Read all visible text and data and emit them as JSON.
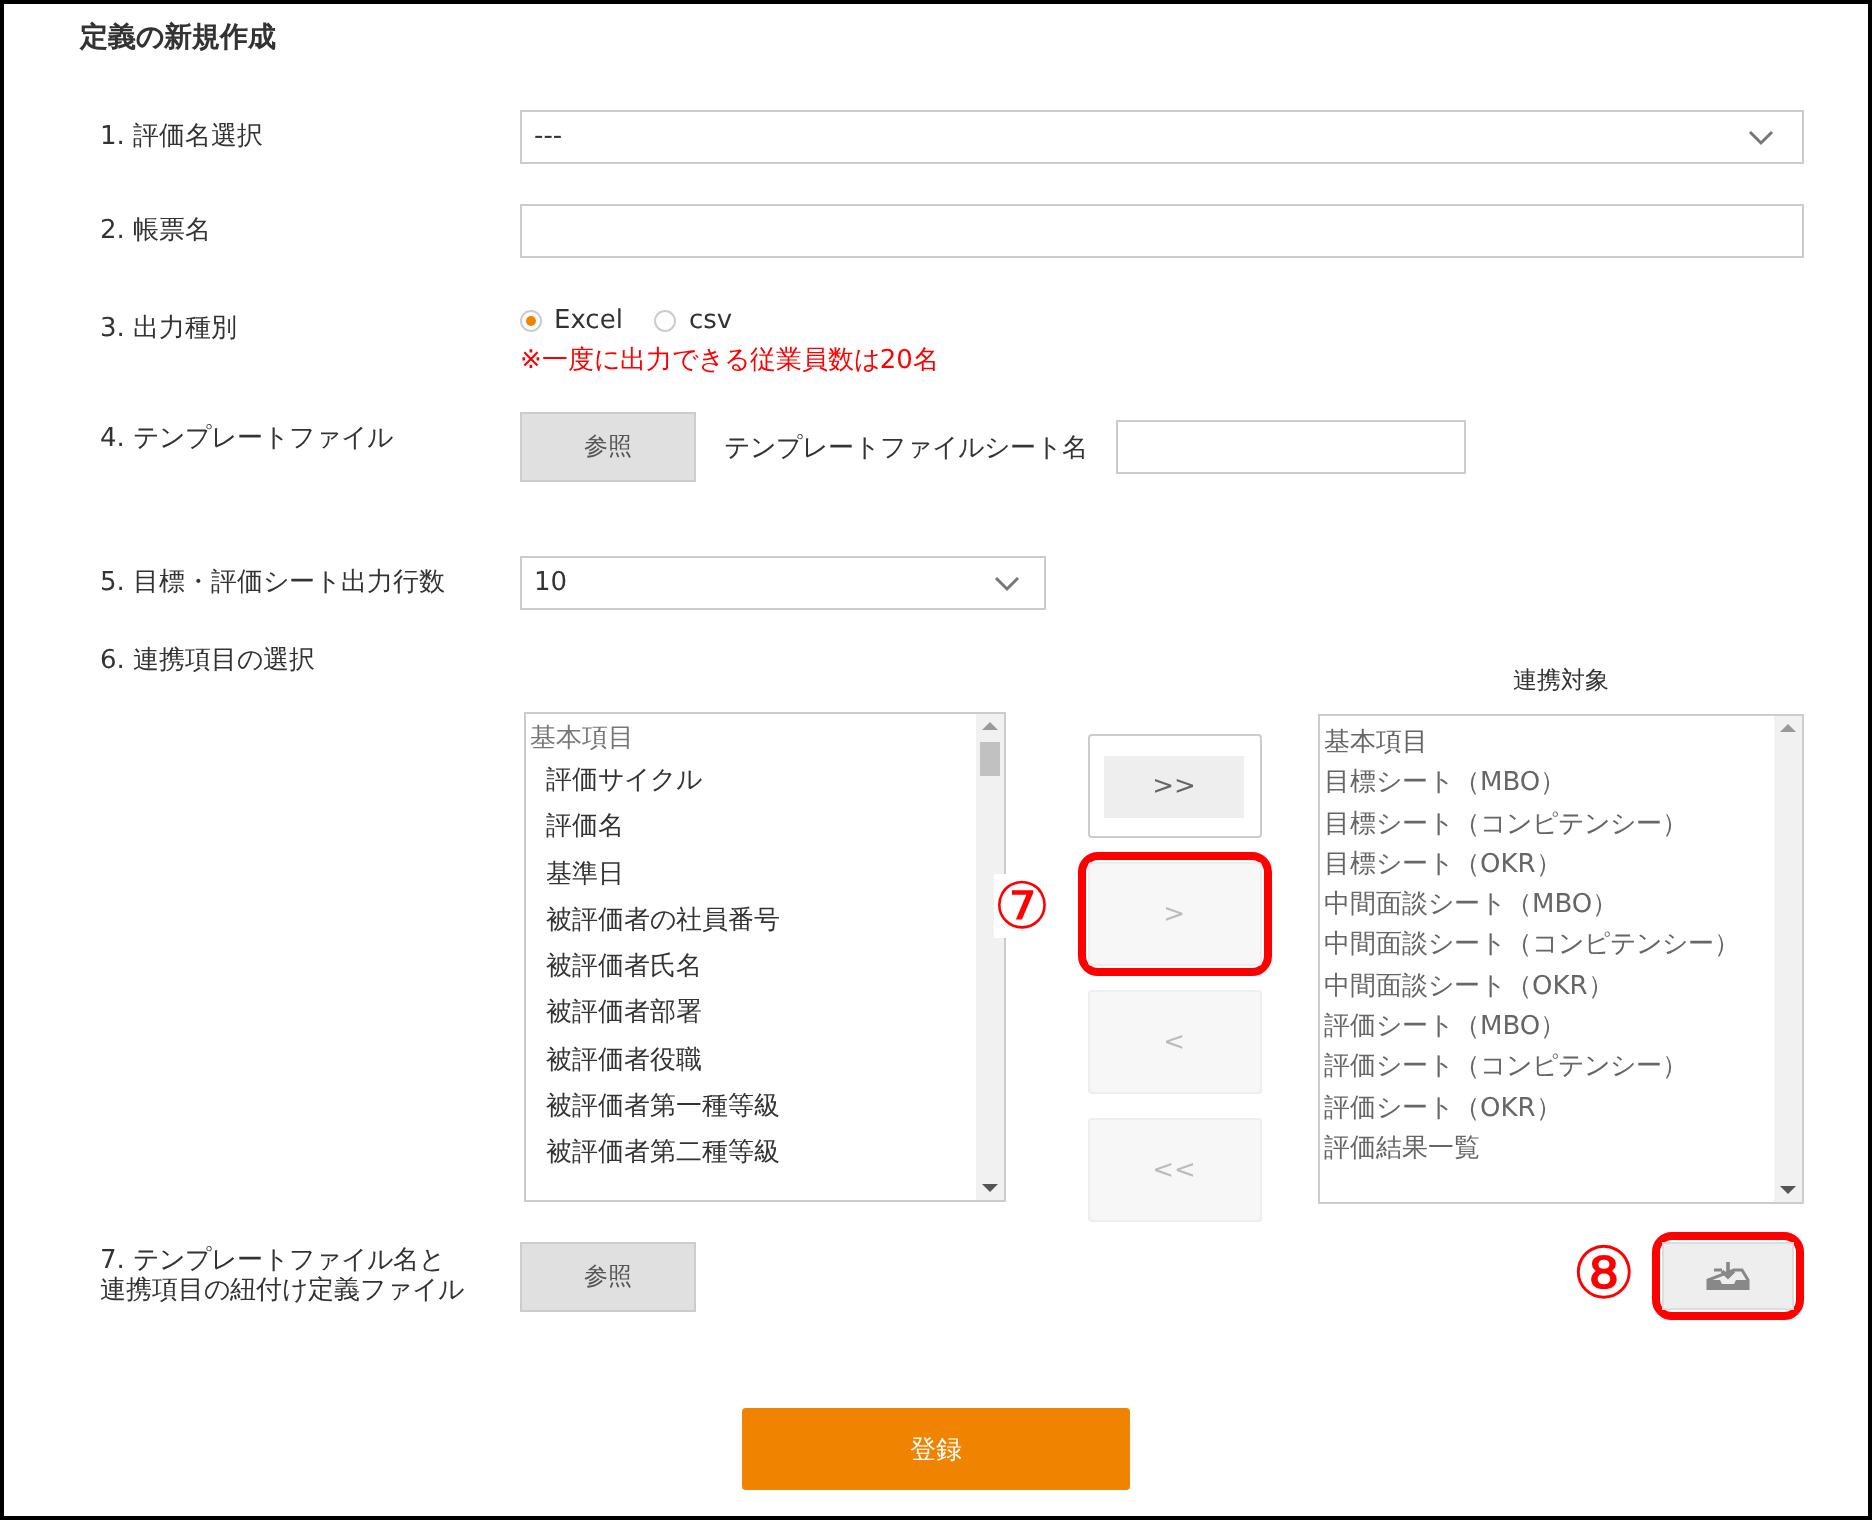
{
  "title": "定義の新規作成",
  "fields": [
    {
      "kind": "select",
      "label": "1. 評価名選択",
      "value": "---"
    },
    {
      "kind": "text",
      "label": "2. 帳票名"
    },
    {
      "kind": "radio",
      "label": "3. 出力種別",
      "options": [
        {
          "label": "Excel",
          "selected": true
        },
        {
          "label": "csv",
          "selected": false
        }
      ],
      "note": "※一度に出力できる従業員数は20名"
    },
    {
      "kind": "file",
      "label": "4. テンプレートファイル",
      "button": "参照",
      "sheet_label": "テンプレートファイルシート名"
    },
    {
      "kind": "select_short",
      "label": "5. 目標・評価シート出力行数",
      "value": "10"
    },
    {
      "kind": "transfer",
      "label": "6. 連携項目の選択",
      "source": {
        "header": "基本項目",
        "items": [
          "評価サイクル",
          "評価名",
          "基準日",
          "被評価者の社員番号",
          "被評価者氏名",
          "被評価者部署",
          "被評価者役職",
          "被評価者第一種等級",
          "被評価者第二種等級"
        ]
      },
      "buttons": [
        {
          "label": ">>",
          "disabled": false,
          "highlighted": false
        },
        {
          "label": ">",
          "disabled": true,
          "highlighted": true,
          "callout": "⑦"
        },
        {
          "label": "<",
          "disabled": true,
          "highlighted": false
        },
        {
          "label": "<<",
          "disabled": true,
          "highlighted": false
        }
      ],
      "target_title": "連携対象",
      "target": [
        "基本項目",
        "目標シート（MBO）",
        "目標シート（コンピテンシー）",
        "目標シート（OKR）",
        "中間面談シート（MBO）",
        "中間面談シート（コンピテンシー）",
        "中間面談シート（OKR）",
        "評価シート（MBO）",
        "評価シート（コンピテンシー）",
        "評価シート（OKR）",
        "評価結果一覧"
      ]
    },
    {
      "kind": "file_download",
      "label_lines": [
        "7. テンプレートファイル名と",
        "連携項目の紐付け定義ファイル"
      ],
      "button": "参照",
      "download_highlighted": true,
      "callout": "⑧"
    }
  ],
  "submit": "登録"
}
